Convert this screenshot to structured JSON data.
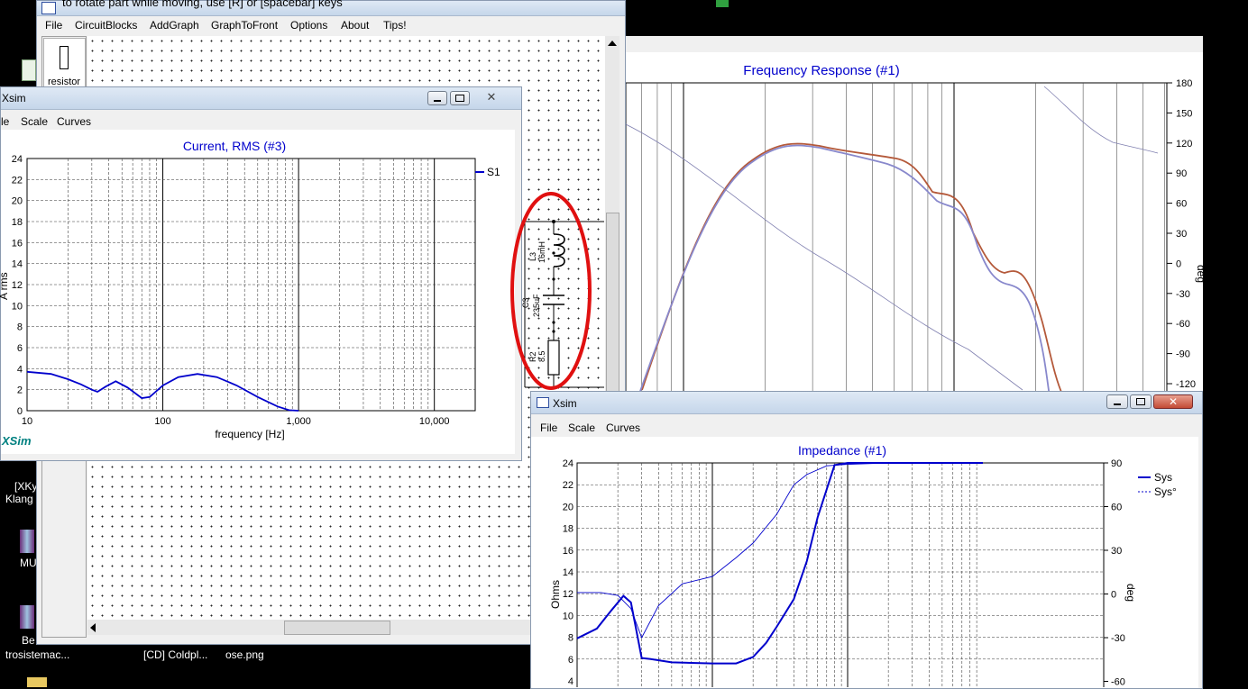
{
  "schematic": {
    "title": "to rotate part while moving, use [R] or [spacebar] keys",
    "menu": [
      "File",
      "CircuitBlocks",
      "AddGraph",
      "GraphToFront",
      "Options",
      "About",
      "Tips!"
    ],
    "palette_label": "resistor",
    "components": [
      {
        "ref": "L3",
        "value": "16mH"
      },
      {
        "ref": "C3",
        "value": "235uF"
      },
      {
        "ref": "R2",
        "value": "8.5"
      }
    ]
  },
  "freq_window": {
    "title": "Frequency Response (#1)",
    "y2_ticks": [
      "180",
      "150",
      "120",
      "90",
      "60",
      "30",
      "0",
      "-30",
      "-60",
      "-90",
      "-120"
    ],
    "y2_label": "deg",
    "colors": {
      "spl1": "#b4593a",
      "spl2": "#8888cc",
      "phase": "#8080b0"
    }
  },
  "current_window": {
    "app_name": "Xsim",
    "menu": [
      "le",
      "Scale",
      "Curves"
    ],
    "chart_data": {
      "type": "line",
      "title": "Current, RMS (#3)",
      "xlabel": "frequency [Hz]",
      "ylabel": "A rms",
      "x_scale": "log",
      "xlim": [
        10,
        20000
      ],
      "ylim": [
        0,
        24
      ],
      "x_tick_labels": [
        "10",
        "100",
        "1,000",
        "10,000"
      ],
      "y_tick_labels": [
        "0",
        "2",
        "4",
        "6",
        "8",
        "10",
        "12",
        "14",
        "16",
        "18",
        "20",
        "22",
        "24"
      ],
      "legend_position": "top-right",
      "series": [
        {
          "name": "S1",
          "color": "#0000cc",
          "x": [
            10,
            15,
            20,
            25,
            30,
            33,
            38,
            45,
            55,
            70,
            80,
            100,
            130,
            180,
            250,
            350,
            500,
            700,
            850,
            1000
          ],
          "y": [
            3.7,
            3.5,
            3.0,
            2.5,
            2.0,
            1.8,
            2.3,
            2.8,
            2.2,
            1.2,
            1.3,
            2.4,
            3.2,
            3.5,
            3.2,
            2.4,
            1.3,
            0.4,
            0.05,
            0.0
          ]
        }
      ]
    },
    "logo": "XSim"
  },
  "impedance_window": {
    "app_name": "Xsim",
    "menu": [
      "File",
      "Scale",
      "Curves"
    ],
    "chart_data": {
      "type": "line",
      "title": "Impedance (#1)",
      "ylabel": "Ohms",
      "y2label": "deg",
      "x_scale": "log",
      "y_tick_labels": [
        "4",
        "6",
        "8",
        "10",
        "12",
        "14",
        "16",
        "18",
        "20",
        "22",
        "24"
      ],
      "y2_tick_labels": [
        "90",
        "60",
        "30",
        "0",
        "-30",
        "-60"
      ],
      "legend_position": "top-right",
      "series": [
        {
          "name": "Sys",
          "color": "#0000cc",
          "axis": "left",
          "x": [
            10,
            14,
            18,
            22,
            25,
            30,
            35,
            50,
            100,
            150,
            200,
            250,
            300,
            400,
            500,
            600,
            800,
            1000,
            2000,
            5000,
            10000
          ],
          "y": [
            7.9,
            8.8,
            10.5,
            11.8,
            11.2,
            6.1,
            6.0,
            5.7,
            5.6,
            5.6,
            6.2,
            7.5,
            9.0,
            11.5,
            15.0,
            19.0,
            23.8,
            24.0,
            24.0,
            24.0,
            24.0
          ]
        },
        {
          "name": "Sys°",
          "color": "#0000cc",
          "axis": "right",
          "style": "dashed",
          "x": [
            10,
            15,
            20,
            25,
            30,
            40,
            60,
            100,
            150,
            200,
            300,
            400,
            500,
            700,
            1000,
            2000,
            10000
          ],
          "y": [
            1,
            1,
            -1,
            -10,
            -30,
            -8,
            7,
            12,
            25,
            35,
            55,
            75,
            82,
            88,
            89,
            90,
            90
          ]
        }
      ]
    }
  },
  "desktop": {
    "labels": [
      "[XKy",
      "Klang",
      "MU",
      "Be",
      "trosistemac...",
      "[CD] Coldpl...",
      "ose.png"
    ]
  }
}
